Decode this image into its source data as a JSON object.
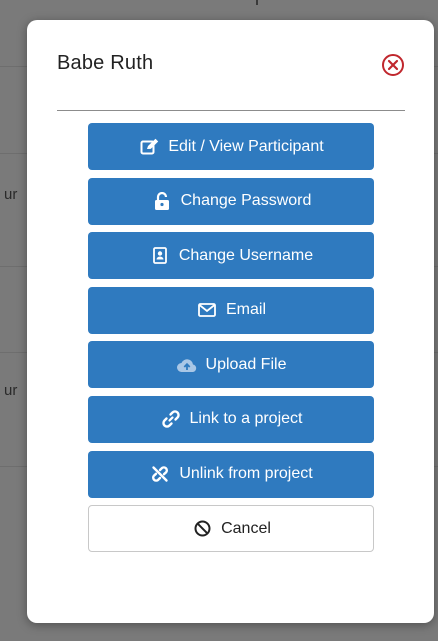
{
  "background": {
    "partial_texts": [
      "ur",
      "ur"
    ]
  },
  "modal": {
    "title": "Babe Ruth",
    "close_icon": "close-circle-icon",
    "accent_color": "#2f7abf",
    "close_color": "#c0272d",
    "actions": [
      {
        "label": "Edit / View Participant",
        "icon": "edit-icon"
      },
      {
        "label": "Change Password",
        "icon": "lock-open-icon"
      },
      {
        "label": "Change Username",
        "icon": "id-card-icon"
      },
      {
        "label": "Email",
        "icon": "envelope-icon"
      },
      {
        "label": "Upload File",
        "icon": "cloud-upload-icon"
      },
      {
        "label": "Link to a project",
        "icon": "link-icon"
      },
      {
        "label": "Unlink from project",
        "icon": "unlink-icon"
      }
    ],
    "cancel": {
      "label": "Cancel",
      "icon": "ban-icon"
    }
  }
}
